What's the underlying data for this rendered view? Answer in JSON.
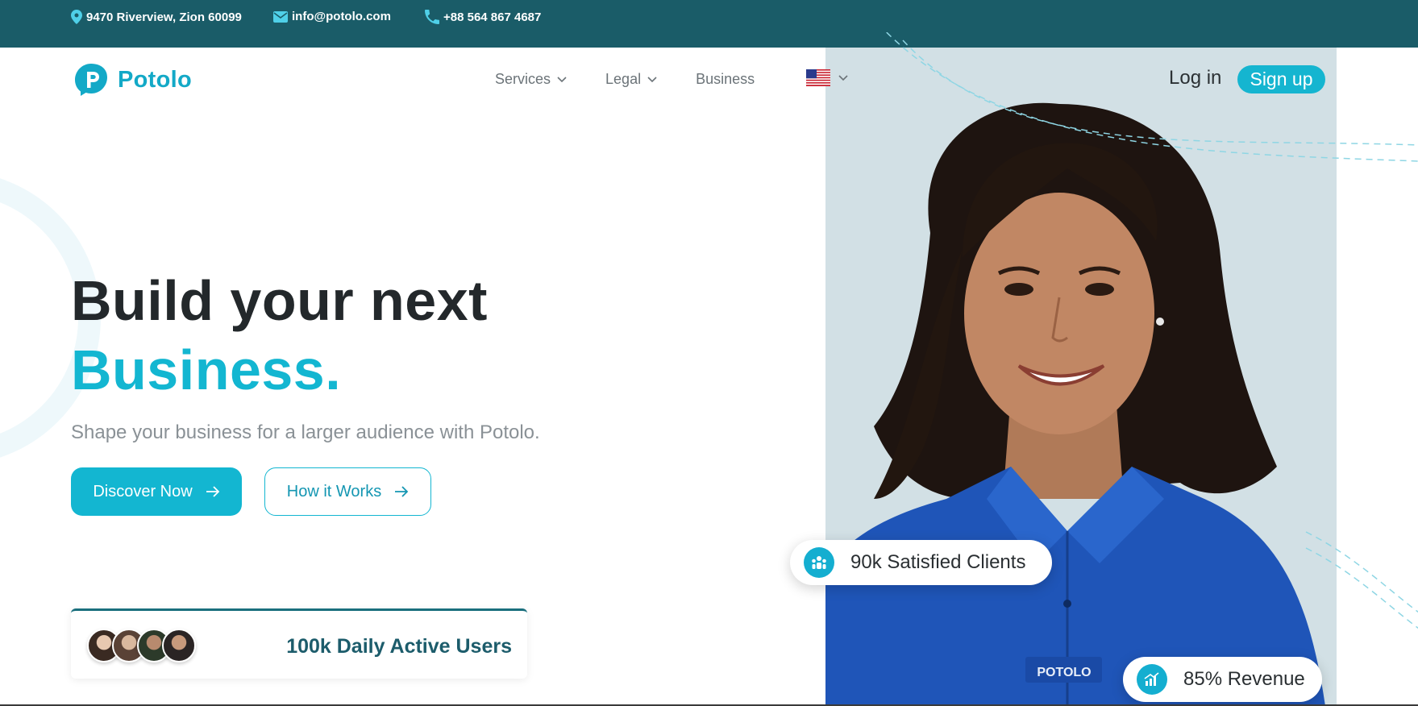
{
  "topbar": {
    "address": "9470 Riverview, Zion 60099",
    "email": "info@potolo.com",
    "phone": "+88 564 867 4687"
  },
  "brand": {
    "name": "Potolo",
    "color": "#13a9c7"
  },
  "nav": {
    "services": "Services",
    "legal": "Legal",
    "business": "Business",
    "language_icon": "us-flag-icon"
  },
  "auth": {
    "login": "Log in",
    "signup": "Sign up"
  },
  "hero": {
    "title_line1": "Build your next",
    "title_line2": "Business.",
    "subtitle": "Shape your business for a larger audience with Potolo.",
    "primary_button": "Discover Now",
    "secondary_button": "How it Works"
  },
  "stats": {
    "daily_users": "100k Daily Active Users",
    "clients": "90k Satisfied Clients",
    "revenue": "85% Revenue"
  },
  "shirt_label": "POTOLO",
  "colors": {
    "topbar": "#1a5c68",
    "accent": "#13b6d1",
    "dark_text": "#23282b",
    "muted_text": "#8a9196"
  }
}
